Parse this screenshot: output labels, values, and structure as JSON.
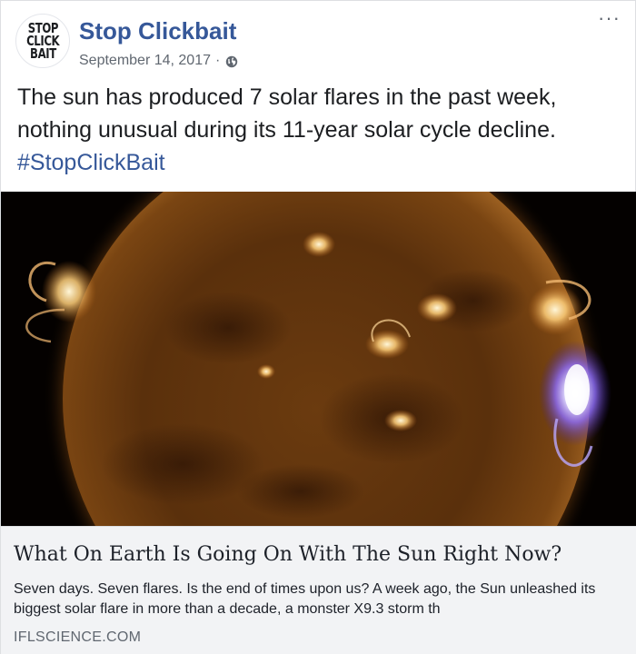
{
  "post": {
    "page_name": "Stop Clickbait",
    "avatar": {
      "line1": "STOP",
      "line2": "CLICK",
      "line3": "BAIT"
    },
    "date": "September 14, 2017",
    "separator": "·",
    "privacy_icon": "globe-icon",
    "more_label": "···",
    "text": "The sun has produced 7 solar flares in the past week, nothing unusual during its 11-year solar cycle decline.",
    "hashtag": "#StopClickBait"
  },
  "photo": {
    "subject": "sun-with-solar-flare-image"
  },
  "link_preview": {
    "title": "What On Earth Is Going On With The Sun Right Now?",
    "description": "Seven days. Seven flares. Is the end of times upon us? A week ago, the Sun unleashed its biggest solar flare in more than a decade, a monster X9.3 storm th",
    "domain": "IFLSCIENCE.COM"
  },
  "colors": {
    "brand_blue": "#365899",
    "text": "#1c1e21",
    "secondary_text": "#606770",
    "link_box_bg": "#f2f3f5"
  }
}
